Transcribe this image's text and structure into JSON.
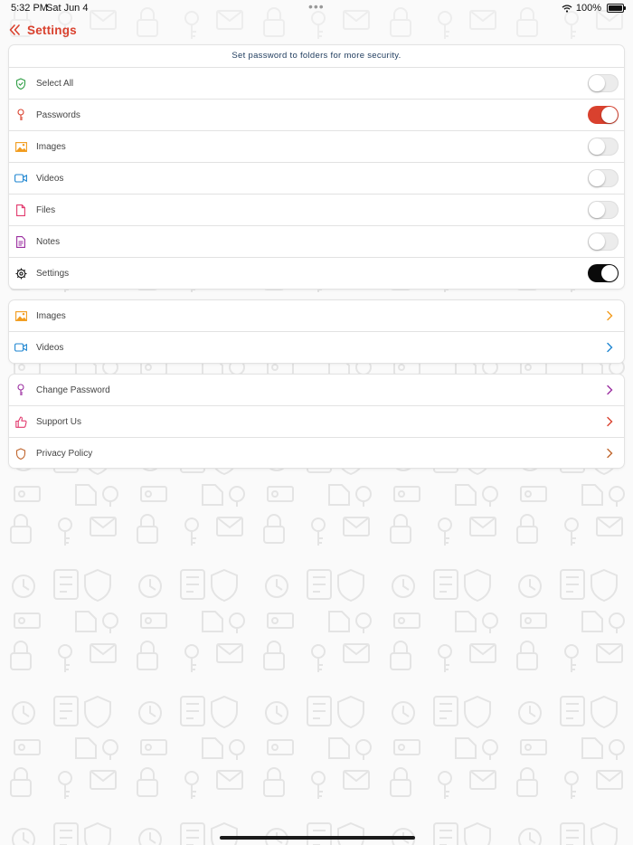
{
  "status_bar": {
    "time": "5:32 PM",
    "date": "Sat Jun 4",
    "dots": "•••",
    "battery": "100%",
    "wifi_icon": "wifi-icon",
    "battery_icon": "battery-icon"
  },
  "header": {
    "back_icon": "double-chevron-left-icon",
    "title": "Settings"
  },
  "lock_section": {
    "notice": "Set password to folders for more security.",
    "items": [
      {
        "label": "Select All",
        "icon": "shield-check-icon",
        "on": false,
        "icon_color": "#2e9e44"
      },
      {
        "label": "Passwords",
        "icon": "key-icon",
        "on": true,
        "icon_color": "#d9412e",
        "toggle_color": "#d9412e"
      },
      {
        "label": "Images",
        "icon": "image-icon",
        "on": false,
        "icon_color": "#f29b1c"
      },
      {
        "label": "Videos",
        "icon": "video-camera-icon",
        "on": false,
        "icon_color": "#1f86d1"
      },
      {
        "label": "Files",
        "icon": "file-icon",
        "on": false,
        "icon_color": "#e23a6e"
      },
      {
        "label": "Notes",
        "icon": "note-icon",
        "on": false,
        "icon_color": "#9b2ea0"
      },
      {
        "label": "Settings",
        "icon": "gear-icon",
        "on": true,
        "icon_color": "#111111",
        "toggle_color": "#0a0a0a"
      }
    ]
  },
  "media_section": {
    "items": [
      {
        "label": "Images",
        "icon": "image-icon",
        "icon_color": "#f29b1c",
        "chevron_color": "#f29b1c"
      },
      {
        "label": "Videos",
        "icon": "video-camera-icon",
        "icon_color": "#1f86d1",
        "chevron_color": "#1f86d1"
      }
    ]
  },
  "other_section": {
    "items": [
      {
        "label": "Change Password",
        "icon": "key-icon",
        "icon_color": "#9b2ea0",
        "chevron_color": "#9b2ea0"
      },
      {
        "label": "Support Us",
        "icon": "thumbs-up-icon",
        "icon_color": "#e23a6e",
        "chevron_color": "#d9412e"
      },
      {
        "label": "Privacy Policy",
        "icon": "shield-icon",
        "icon_color": "#c0662e",
        "chevron_color": "#c0662e"
      }
    ]
  },
  "colors": {
    "accent": "#d9412e",
    "card_bg": "#ffffff",
    "page_bg": "#fafafa"
  }
}
